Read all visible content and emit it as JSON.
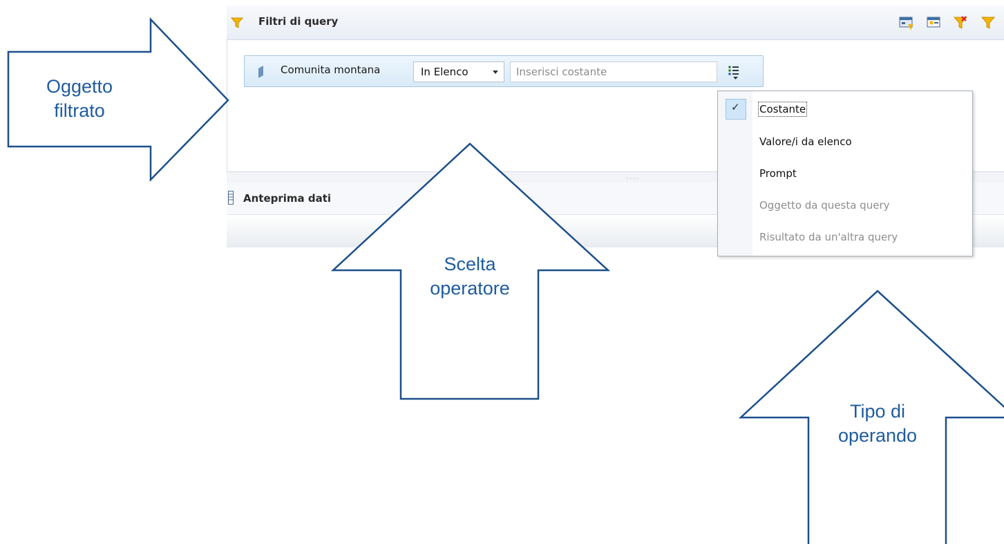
{
  "app": {
    "query_filters": {
      "title": "Filtri di query",
      "filter": {
        "object_label": "Comunita montana",
        "operator_value": "In Elenco",
        "operand_placeholder": "Inserisci costante"
      }
    },
    "data_preview": {
      "title": "Anteprima dati"
    },
    "operand_menu": {
      "items": [
        {
          "label": "Costante",
          "checked": true,
          "enabled": true
        },
        {
          "label": "Valore/i da elenco",
          "checked": false,
          "enabled": true
        },
        {
          "label": "Prompt",
          "checked": false,
          "enabled": true
        },
        {
          "label": "Oggetto da questa query",
          "checked": false,
          "enabled": false
        },
        {
          "label": "Risultato da un'altra query",
          "checked": false,
          "enabled": false
        }
      ]
    }
  },
  "annotations": {
    "filtered_object": {
      "line1": "Oggetto",
      "line2": "filtrato"
    },
    "operator_choice": {
      "line1": "Scelta",
      "line2": "operatore"
    },
    "operand_type": {
      "line1": "Tipo di",
      "line2": "operando"
    }
  },
  "colors": {
    "annotation": "#1f5c9e",
    "funnel": "#f4b400",
    "menu_check_bg": "#cfe5f8",
    "filter_row_bg": "#d8eaf8"
  },
  "icons": {
    "header_funnel": "funnel-icon",
    "object": "dimension-object-icon",
    "operand_type": "operand-list-icon",
    "check": "checkmark-icon"
  }
}
